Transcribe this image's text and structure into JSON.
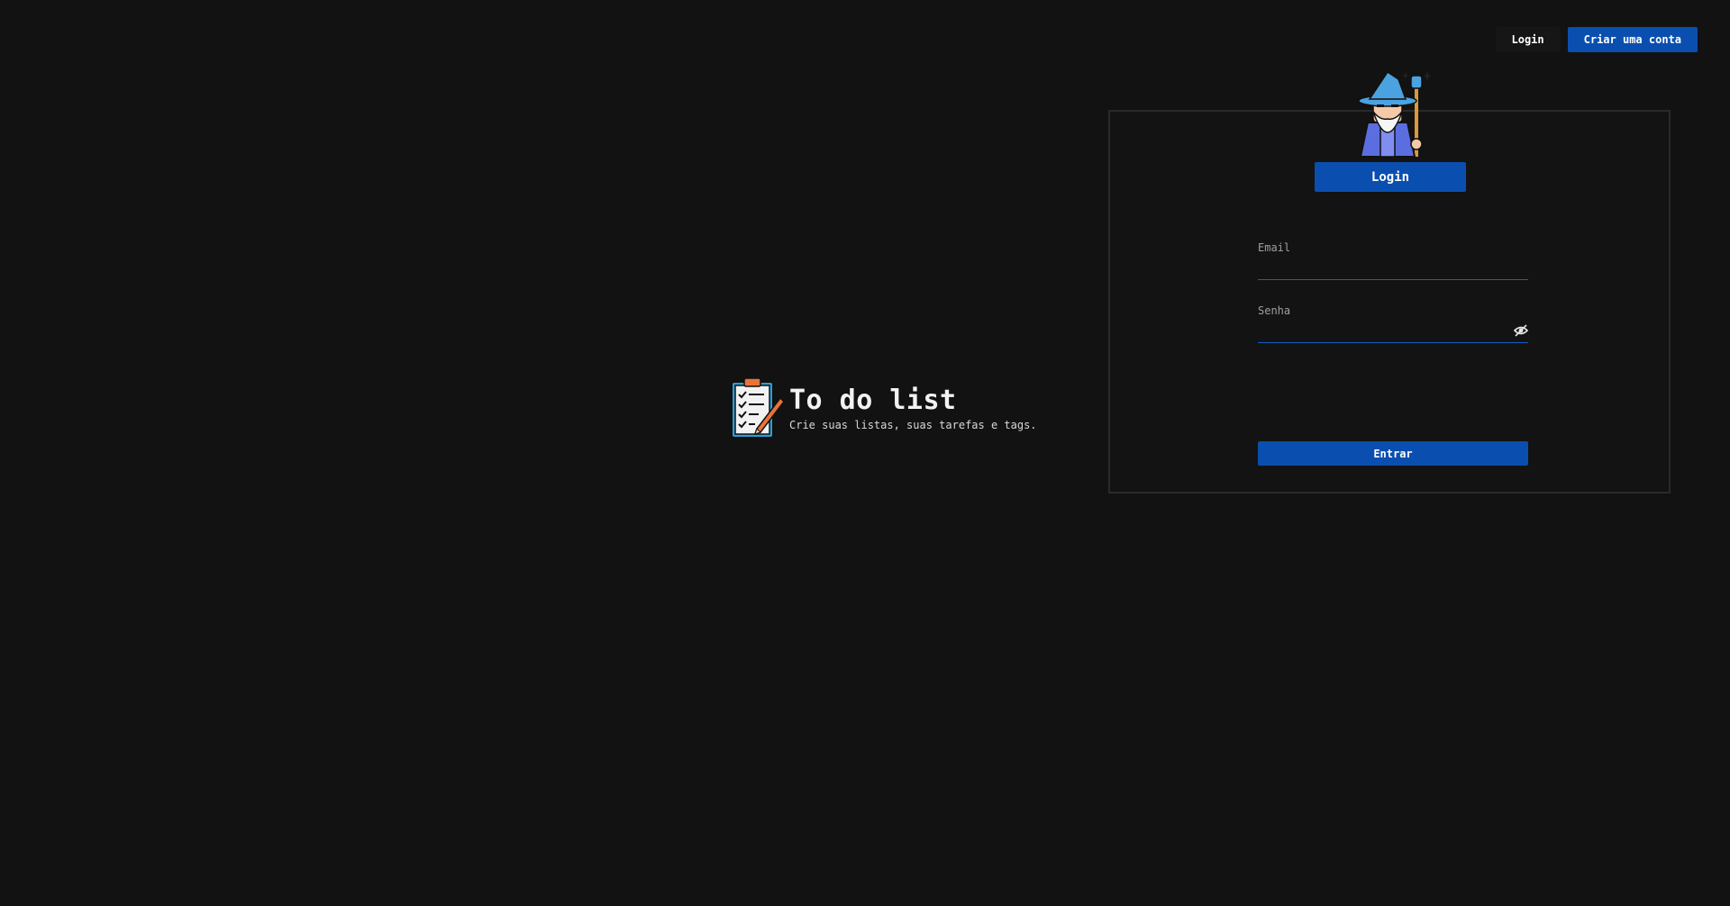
{
  "nav": {
    "login_label": "Login",
    "signup_label": "Criar uma conta"
  },
  "brand": {
    "title": "To do list",
    "subtitle": "Crie suas listas, suas tarefas e tags.",
    "icon": "clipboard-checklist-pencil-icon"
  },
  "login_card": {
    "avatar_icon": "wizard-icon",
    "title": "Login",
    "email": {
      "label": "Email",
      "value": "",
      "placeholder": ""
    },
    "password": {
      "label": "Senha",
      "value": "",
      "placeholder": "",
      "toggle_icon": "eye-slash-icon"
    },
    "submit_label": "Entrar"
  },
  "colors": {
    "background": "#121212",
    "accent": "#0a4fb0",
    "input_underline": "#1560c8",
    "card_border": "#2a2a2a"
  }
}
